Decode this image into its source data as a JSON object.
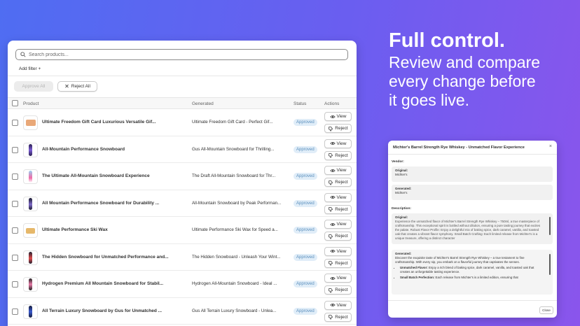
{
  "search": {
    "placeholder": "Search products..."
  },
  "filters": {
    "add_filter_label": "Add filter +"
  },
  "bulk_actions": {
    "approve_all_label": "Approve All",
    "reject_all_label": "Reject All"
  },
  "table": {
    "columns": {
      "product": "Product",
      "generated": "Generated",
      "status": "Status",
      "actions": "Actions"
    },
    "view_label": "View",
    "reject_label": "Reject",
    "rows": [
      {
        "product": "Ultimate Freedom Gift Card Luxurious Versatile Gif...",
        "generated": "Ultimate Freedom Gift Card - Perfect Gif...",
        "status": "Approved",
        "thumb": "gift-card"
      },
      {
        "product": "All-Mountain Performance Snowboard",
        "generated": "Gus All-Mountain Snowboard for Thrilling...",
        "status": "Approved",
        "thumb": "snowboard-purple"
      },
      {
        "product": "The Ultimate All-Mountain Snowboard Experience",
        "generated": "The Draft All-Mountain Snowboard for Thr...",
        "status": "Approved",
        "thumb": "snowboard-blue"
      },
      {
        "product": "All Mountain Performance Snowboard for Durability ...",
        "generated": "All-Mountain Snowboard by Peak Performan...",
        "status": "Approved",
        "thumb": "snowboard-dark"
      },
      {
        "product": "Ultimate Performance Ski Wax",
        "generated": "Ultimate Performance Ski Wax for Speed a...",
        "status": "Approved",
        "thumb": "ski-wax"
      },
      {
        "product": "The Hidden Snowboard for Unmatched Performance and...",
        "generated": "The Hidden Snowboard - Unleash Your Wint...",
        "status": "Approved",
        "thumb": "snowboard-red"
      },
      {
        "product": "Hydrogen Premium All Mountain Snowboard for Stabil...",
        "generated": "Hydrogen All-Mountain Snowboard - Ideal ...",
        "status": "Approved",
        "thumb": "snowboard-pink"
      },
      {
        "product": "All Terrain Luxury Snowboard by Gus for Unmatched ...",
        "generated": "Gus All Terrain Luxury Snowboard - Unlea...",
        "status": "Approved",
        "thumb": "snowboard-navy"
      }
    ]
  },
  "headline": {
    "title": "Full control.",
    "lines": [
      "Review and compare",
      "every change before",
      "it goes live."
    ]
  },
  "modal": {
    "title": "Michter's Barrel Strength Rye Whiskey - Unmatched Flavor Experience",
    "close_glyph": "×",
    "vendor_label": "Vendor:",
    "vendor_original_label": "Original:",
    "vendor_original_value": "Michter's",
    "vendor_generated_label": "Generated:",
    "vendor_generated_value": "Michter's",
    "description_label": "Description:",
    "desc_original_label": "Original:",
    "desc_original_text": "Experience the unmatched flavor of Michter's Barrel Strength Rye Whiskey – 750ml, a true masterpiece of craftsmanship. This exceptional spirit is bottled without dilution, ensuring a pure tasting journey that excites the palate. Robust Flavor Profile: Enjoy a delightful mix of baking spice, dark caramel, vanilla, and toasted oak that creates a vibrant flavor symphony. Small Batch Crafting: Each limited release from Michter's is a unique treasure, offering a distinct character",
    "desc_generated_label": "Generated:",
    "desc_generated_text": "Discover the exquisite taste of Michter's Barrel Strength Rye Whiskey – a true testament to fine craftsmanship. With every sip, you embark on a flavorful journey that captivates the senses.",
    "bullet1_bold": "Unmatched Flavor:",
    "bullet1_text": " Enjoy a rich blend of baking spice, dark caramel, vanilla, and toasted oak that creates an unforgettable tasting experience.",
    "bullet2_bold": "Small Batch Perfection:",
    "bullet2_text": " Each release from Michter's is a limited edition, ensuring that",
    "close_button_label": "Close"
  },
  "colors": {
    "background_start": "#4f6df2",
    "background_end": "#8a55ec",
    "badge_bg": "#e0edf8",
    "badge_text": "#5a8fbd"
  }
}
